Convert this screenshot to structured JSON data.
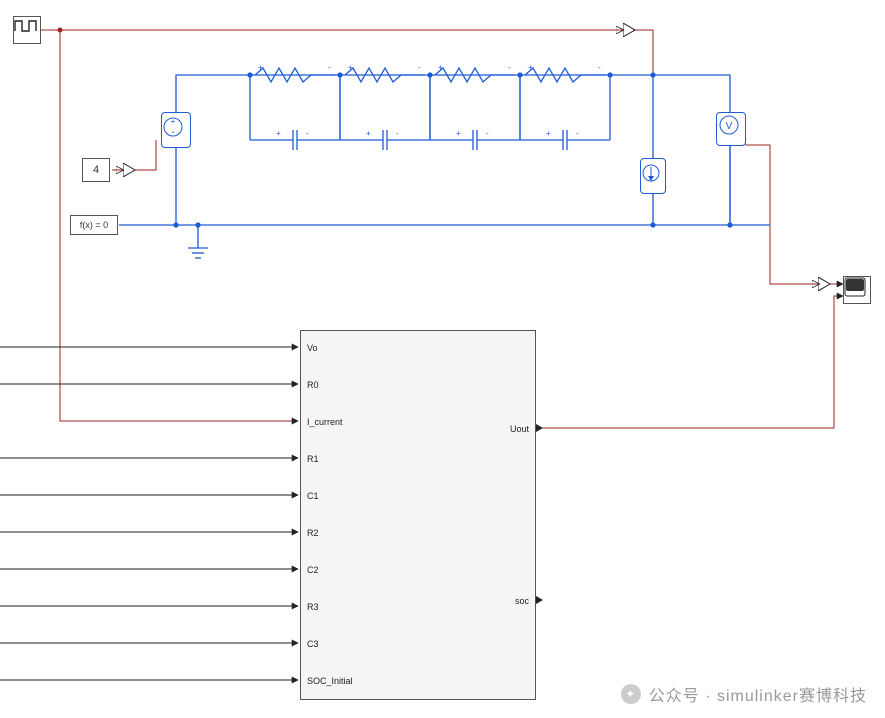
{
  "blocks": {
    "pulse": {
      "icon": "pulse"
    },
    "constant": {
      "value": "4"
    },
    "solver": {
      "label": "f(x) = 0"
    },
    "voltmeter": {
      "letter": "V"
    },
    "scope": {
      "icon": "scope"
    }
  },
  "rc_pairs": [
    {
      "r_plus": "+",
      "r_minus": "-",
      "c_plus": "+",
      "c_minus": "-"
    },
    {
      "r_plus": "+",
      "r_minus": "-",
      "c_plus": "+",
      "c_minus": "-"
    },
    {
      "r_plus": "+",
      "r_minus": "-",
      "c_plus": "+",
      "c_minus": "-"
    },
    {
      "r_plus": "+",
      "r_minus": "-",
      "c_plus": "+",
      "c_minus": "-"
    }
  ],
  "subsystem": {
    "inputs": [
      "Vo",
      "R0",
      "I_current",
      "R1",
      "C1",
      "R2",
      "C2",
      "R3",
      "C3",
      "SOC_Initial"
    ],
    "outputs": [
      "Uout",
      "soc"
    ]
  },
  "watermark": {
    "prefix": "公众号 · ",
    "name": "simulinker赛博科技"
  },
  "colors": {
    "signal": "#a02020",
    "elec": "#1e5bd6",
    "line": "#222"
  }
}
